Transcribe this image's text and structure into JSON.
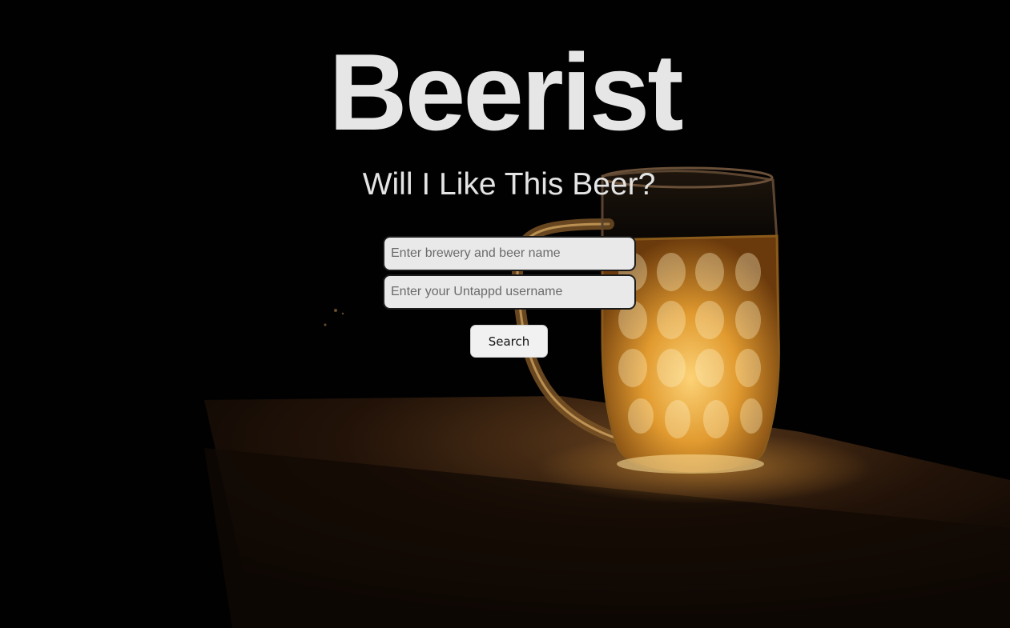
{
  "app": {
    "title": "Beerist",
    "subtitle": "Will I Like This Beer?"
  },
  "search_form": {
    "beer_field": {
      "placeholder": "Enter brewery and beer name",
      "value": ""
    },
    "username_field": {
      "placeholder": "Enter your Untappd username",
      "value": ""
    },
    "search_label": "Search"
  },
  "background": {
    "image": "beer-mug-on-ledge",
    "colors": {
      "base": "#020101",
      "beer_glow": "#f0a83c",
      "ledge": "#5a3a1c"
    }
  },
  "theme": {
    "title_color": "#e6e6e6",
    "field_bg": "#e9e9e9",
    "button_bg": "#f1f1f1"
  }
}
